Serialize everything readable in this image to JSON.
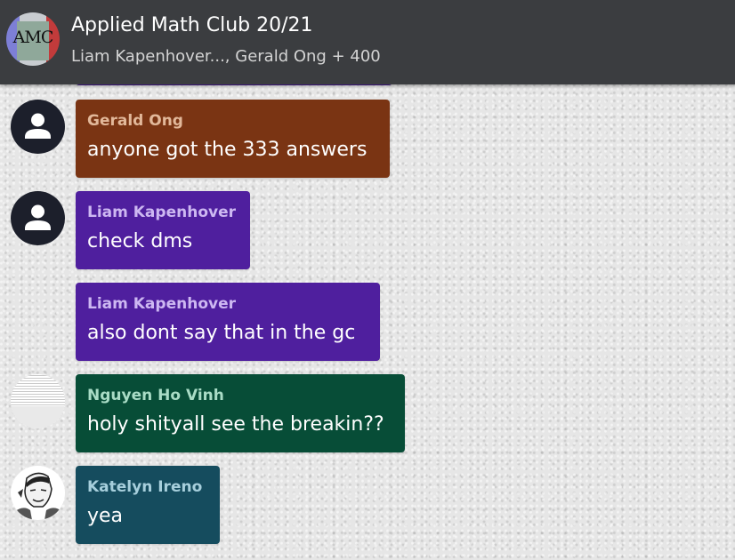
{
  "header": {
    "avatar_text": "AMC",
    "title": "Applied Math Club 20/21",
    "subtitle": "Liam Kapenhover..., Gerald Ong + 400"
  },
  "messages": [
    {
      "sender": "Gerald Ong",
      "text": "anyone got the 333 answers",
      "bubble_color": "#7a3413",
      "sender_color": "#e2b89a",
      "avatar": "default-user-icon"
    },
    {
      "sender": "Liam Kapenhover",
      "text": "check dms",
      "bubble_color": "#4f1f9e",
      "sender_color": "#cdb8f2",
      "avatar": "default-user-icon"
    },
    {
      "sender": "Liam Kapenhover",
      "text": "also dont say that in the gc",
      "bubble_color": "#4f1f9e",
      "sender_color": "#cdb8f2",
      "avatar": "none"
    },
    {
      "sender": "Nguyen Ho Vinh",
      "text": "holy shityall see the breakin??",
      "bubble_color": "#074d37",
      "sender_color": "#a9dcc6",
      "avatar": "photo"
    },
    {
      "sender": "Katelyn Ireno",
      "text": "yea",
      "bubble_color": "#154c5e",
      "sender_color": "#a7cfdc",
      "avatar": "sketch-photo"
    }
  ]
}
